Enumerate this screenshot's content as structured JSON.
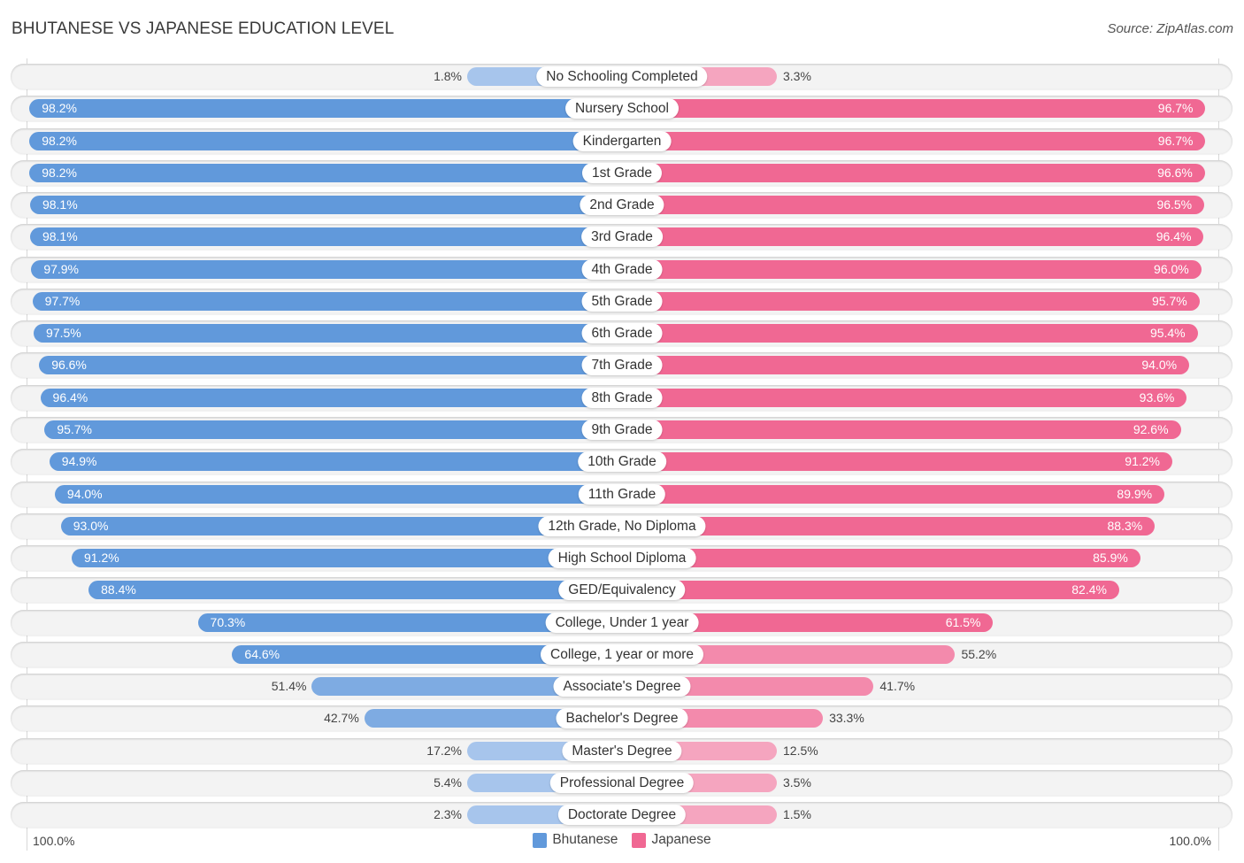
{
  "header": {
    "title": "BHUTANESE VS JAPANESE EDUCATION LEVEL",
    "source": "Source: ZipAtlas.com"
  },
  "colors": {
    "bhutanese": "#6199db",
    "bhutanese_light": "#a7c5ec",
    "japanese": "#f06893",
    "japanese_light": "#f5a5bf"
  },
  "axis": {
    "left_label": "100.0%",
    "right_label": "100.0%"
  },
  "legend": [
    {
      "label": "Bhutanese",
      "color": "#6199db"
    },
    {
      "label": "Japanese",
      "color": "#f06893"
    }
  ],
  "chart_data": {
    "type": "bar",
    "orientation": "horizontal-diverging",
    "title": "BHUTANESE VS JAPANESE EDUCATION LEVEL",
    "xlabel": "",
    "ylabel": "",
    "xlim": [
      0,
      100
    ],
    "unit": "%",
    "legend_position": "bottom-center",
    "categories": [
      "No Schooling Completed",
      "Nursery School",
      "Kindergarten",
      "1st Grade",
      "2nd Grade",
      "3rd Grade",
      "4th Grade",
      "5th Grade",
      "6th Grade",
      "7th Grade",
      "8th Grade",
      "9th Grade",
      "10th Grade",
      "11th Grade",
      "12th Grade, No Diploma",
      "High School Diploma",
      "GED/Equivalency",
      "College, Under 1 year",
      "College, 1 year or more",
      "Associate's Degree",
      "Bachelor's Degree",
      "Master's Degree",
      "Professional Degree",
      "Doctorate Degree"
    ],
    "series": [
      {
        "name": "Bhutanese",
        "side": "left",
        "values": [
          1.8,
          98.2,
          98.2,
          98.2,
          98.1,
          98.1,
          97.9,
          97.7,
          97.5,
          96.6,
          96.4,
          95.7,
          94.9,
          94.0,
          93.0,
          91.2,
          88.4,
          70.3,
          64.6,
          51.4,
          42.7,
          17.2,
          5.4,
          2.3
        ],
        "labels": [
          "1.8%",
          "98.2%",
          "98.2%",
          "98.2%",
          "98.1%",
          "98.1%",
          "97.9%",
          "97.7%",
          "97.5%",
          "96.6%",
          "96.4%",
          "95.7%",
          "94.9%",
          "94.0%",
          "93.0%",
          "91.2%",
          "88.4%",
          "70.3%",
          "64.6%",
          "51.4%",
          "42.7%",
          "17.2%",
          "5.4%",
          "2.3%"
        ]
      },
      {
        "name": "Japanese",
        "side": "right",
        "values": [
          3.3,
          96.7,
          96.7,
          96.6,
          96.5,
          96.4,
          96.0,
          95.7,
          95.4,
          94.0,
          93.6,
          92.6,
          91.2,
          89.9,
          88.3,
          85.9,
          82.4,
          61.5,
          55.2,
          41.7,
          33.3,
          12.5,
          3.5,
          1.5
        ],
        "labels": [
          "3.3%",
          "96.7%",
          "96.7%",
          "96.6%",
          "96.5%",
          "96.4%",
          "96.0%",
          "95.7%",
          "95.4%",
          "94.0%",
          "93.6%",
          "92.6%",
          "91.2%",
          "89.9%",
          "88.3%",
          "85.9%",
          "82.4%",
          "61.5%",
          "55.2%",
          "41.7%",
          "33.3%",
          "12.5%",
          "3.5%",
          "1.5%"
        ]
      }
    ]
  }
}
